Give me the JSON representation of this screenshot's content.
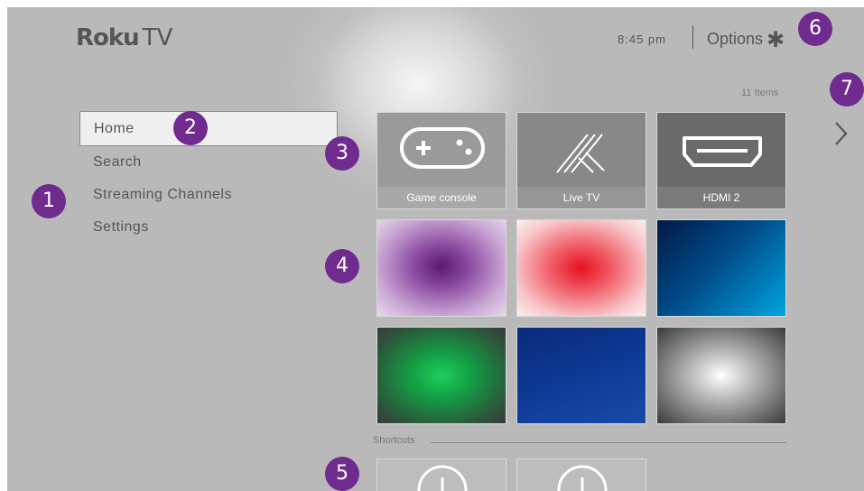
{
  "header": {
    "logo_brand": "Roku",
    "logo_suffix": "TV",
    "time": "8:45  pm",
    "options_label": "Options",
    "options_icon": "asterisk-icon"
  },
  "grid": {
    "items_count": "11 Items",
    "next_icon": "chevron-right-icon",
    "inputs": [
      {
        "label": "Game console",
        "icon": "gamepad-icon"
      },
      {
        "label": "Live TV",
        "icon": "antenna-icon"
      },
      {
        "label": "HDMI 2",
        "icon": "hdmi-icon"
      }
    ]
  },
  "menu": {
    "items": [
      {
        "label": "Home",
        "selected": true
      },
      {
        "label": "Search"
      },
      {
        "label": "Streaming Channels"
      },
      {
        "label": "Settings"
      }
    ]
  },
  "shortcuts": {
    "label": "Shortcuts"
  },
  "callouts": [
    "1",
    "2",
    "3",
    "4",
    "5",
    "6",
    "7"
  ],
  "colors": {
    "callout": "#6f2b8e",
    "text": "#555555"
  }
}
